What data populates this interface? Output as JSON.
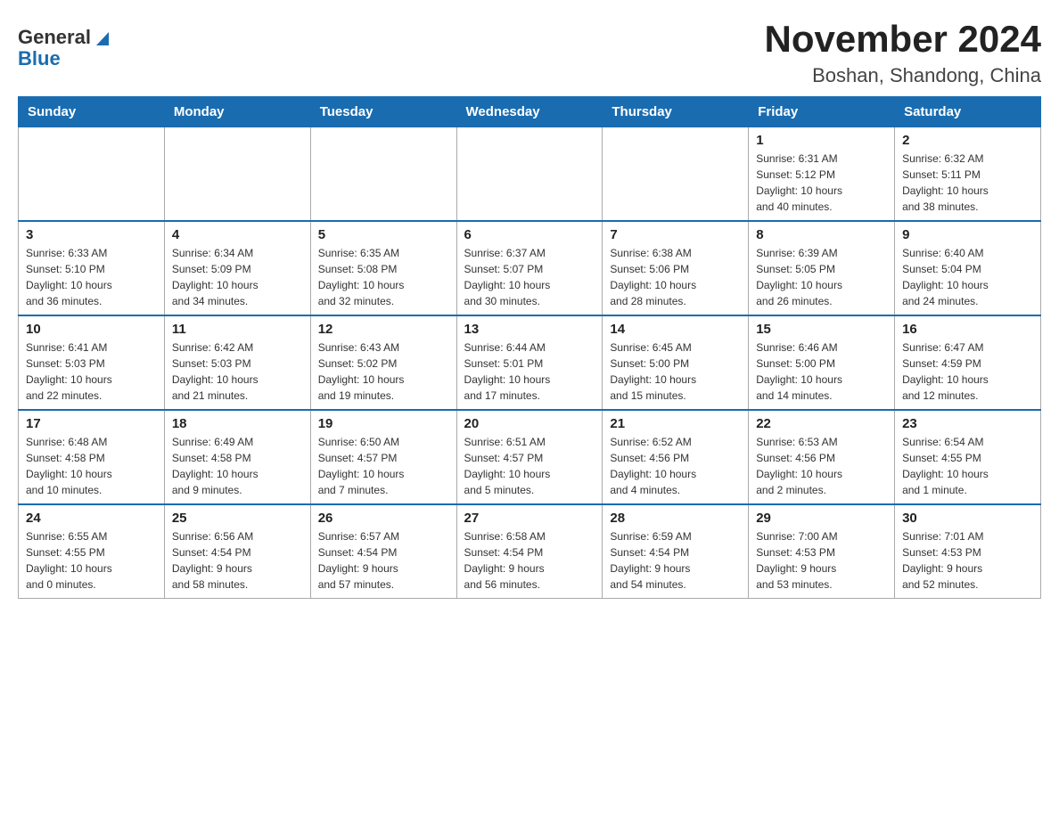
{
  "logo": {
    "general": "General",
    "blue": "Blue"
  },
  "title": "November 2024",
  "subtitle": "Boshan, Shandong, China",
  "weekdays": [
    "Sunday",
    "Monday",
    "Tuesday",
    "Wednesday",
    "Thursday",
    "Friday",
    "Saturday"
  ],
  "weeks": [
    [
      {
        "day": "",
        "info": ""
      },
      {
        "day": "",
        "info": ""
      },
      {
        "day": "",
        "info": ""
      },
      {
        "day": "",
        "info": ""
      },
      {
        "day": "",
        "info": ""
      },
      {
        "day": "1",
        "info": "Sunrise: 6:31 AM\nSunset: 5:12 PM\nDaylight: 10 hours\nand 40 minutes."
      },
      {
        "day": "2",
        "info": "Sunrise: 6:32 AM\nSunset: 5:11 PM\nDaylight: 10 hours\nand 38 minutes."
      }
    ],
    [
      {
        "day": "3",
        "info": "Sunrise: 6:33 AM\nSunset: 5:10 PM\nDaylight: 10 hours\nand 36 minutes."
      },
      {
        "day": "4",
        "info": "Sunrise: 6:34 AM\nSunset: 5:09 PM\nDaylight: 10 hours\nand 34 minutes."
      },
      {
        "day": "5",
        "info": "Sunrise: 6:35 AM\nSunset: 5:08 PM\nDaylight: 10 hours\nand 32 minutes."
      },
      {
        "day": "6",
        "info": "Sunrise: 6:37 AM\nSunset: 5:07 PM\nDaylight: 10 hours\nand 30 minutes."
      },
      {
        "day": "7",
        "info": "Sunrise: 6:38 AM\nSunset: 5:06 PM\nDaylight: 10 hours\nand 28 minutes."
      },
      {
        "day": "8",
        "info": "Sunrise: 6:39 AM\nSunset: 5:05 PM\nDaylight: 10 hours\nand 26 minutes."
      },
      {
        "day": "9",
        "info": "Sunrise: 6:40 AM\nSunset: 5:04 PM\nDaylight: 10 hours\nand 24 minutes."
      }
    ],
    [
      {
        "day": "10",
        "info": "Sunrise: 6:41 AM\nSunset: 5:03 PM\nDaylight: 10 hours\nand 22 minutes."
      },
      {
        "day": "11",
        "info": "Sunrise: 6:42 AM\nSunset: 5:03 PM\nDaylight: 10 hours\nand 21 minutes."
      },
      {
        "day": "12",
        "info": "Sunrise: 6:43 AM\nSunset: 5:02 PM\nDaylight: 10 hours\nand 19 minutes."
      },
      {
        "day": "13",
        "info": "Sunrise: 6:44 AM\nSunset: 5:01 PM\nDaylight: 10 hours\nand 17 minutes."
      },
      {
        "day": "14",
        "info": "Sunrise: 6:45 AM\nSunset: 5:00 PM\nDaylight: 10 hours\nand 15 minutes."
      },
      {
        "day": "15",
        "info": "Sunrise: 6:46 AM\nSunset: 5:00 PM\nDaylight: 10 hours\nand 14 minutes."
      },
      {
        "day": "16",
        "info": "Sunrise: 6:47 AM\nSunset: 4:59 PM\nDaylight: 10 hours\nand 12 minutes."
      }
    ],
    [
      {
        "day": "17",
        "info": "Sunrise: 6:48 AM\nSunset: 4:58 PM\nDaylight: 10 hours\nand 10 minutes."
      },
      {
        "day": "18",
        "info": "Sunrise: 6:49 AM\nSunset: 4:58 PM\nDaylight: 10 hours\nand 9 minutes."
      },
      {
        "day": "19",
        "info": "Sunrise: 6:50 AM\nSunset: 4:57 PM\nDaylight: 10 hours\nand 7 minutes."
      },
      {
        "day": "20",
        "info": "Sunrise: 6:51 AM\nSunset: 4:57 PM\nDaylight: 10 hours\nand 5 minutes."
      },
      {
        "day": "21",
        "info": "Sunrise: 6:52 AM\nSunset: 4:56 PM\nDaylight: 10 hours\nand 4 minutes."
      },
      {
        "day": "22",
        "info": "Sunrise: 6:53 AM\nSunset: 4:56 PM\nDaylight: 10 hours\nand 2 minutes."
      },
      {
        "day": "23",
        "info": "Sunrise: 6:54 AM\nSunset: 4:55 PM\nDaylight: 10 hours\nand 1 minute."
      }
    ],
    [
      {
        "day": "24",
        "info": "Sunrise: 6:55 AM\nSunset: 4:55 PM\nDaylight: 10 hours\nand 0 minutes."
      },
      {
        "day": "25",
        "info": "Sunrise: 6:56 AM\nSunset: 4:54 PM\nDaylight: 9 hours\nand 58 minutes."
      },
      {
        "day": "26",
        "info": "Sunrise: 6:57 AM\nSunset: 4:54 PM\nDaylight: 9 hours\nand 57 minutes."
      },
      {
        "day": "27",
        "info": "Sunrise: 6:58 AM\nSunset: 4:54 PM\nDaylight: 9 hours\nand 56 minutes."
      },
      {
        "day": "28",
        "info": "Sunrise: 6:59 AM\nSunset: 4:54 PM\nDaylight: 9 hours\nand 54 minutes."
      },
      {
        "day": "29",
        "info": "Sunrise: 7:00 AM\nSunset: 4:53 PM\nDaylight: 9 hours\nand 53 minutes."
      },
      {
        "day": "30",
        "info": "Sunrise: 7:01 AM\nSunset: 4:53 PM\nDaylight: 9 hours\nand 52 minutes."
      }
    ]
  ]
}
